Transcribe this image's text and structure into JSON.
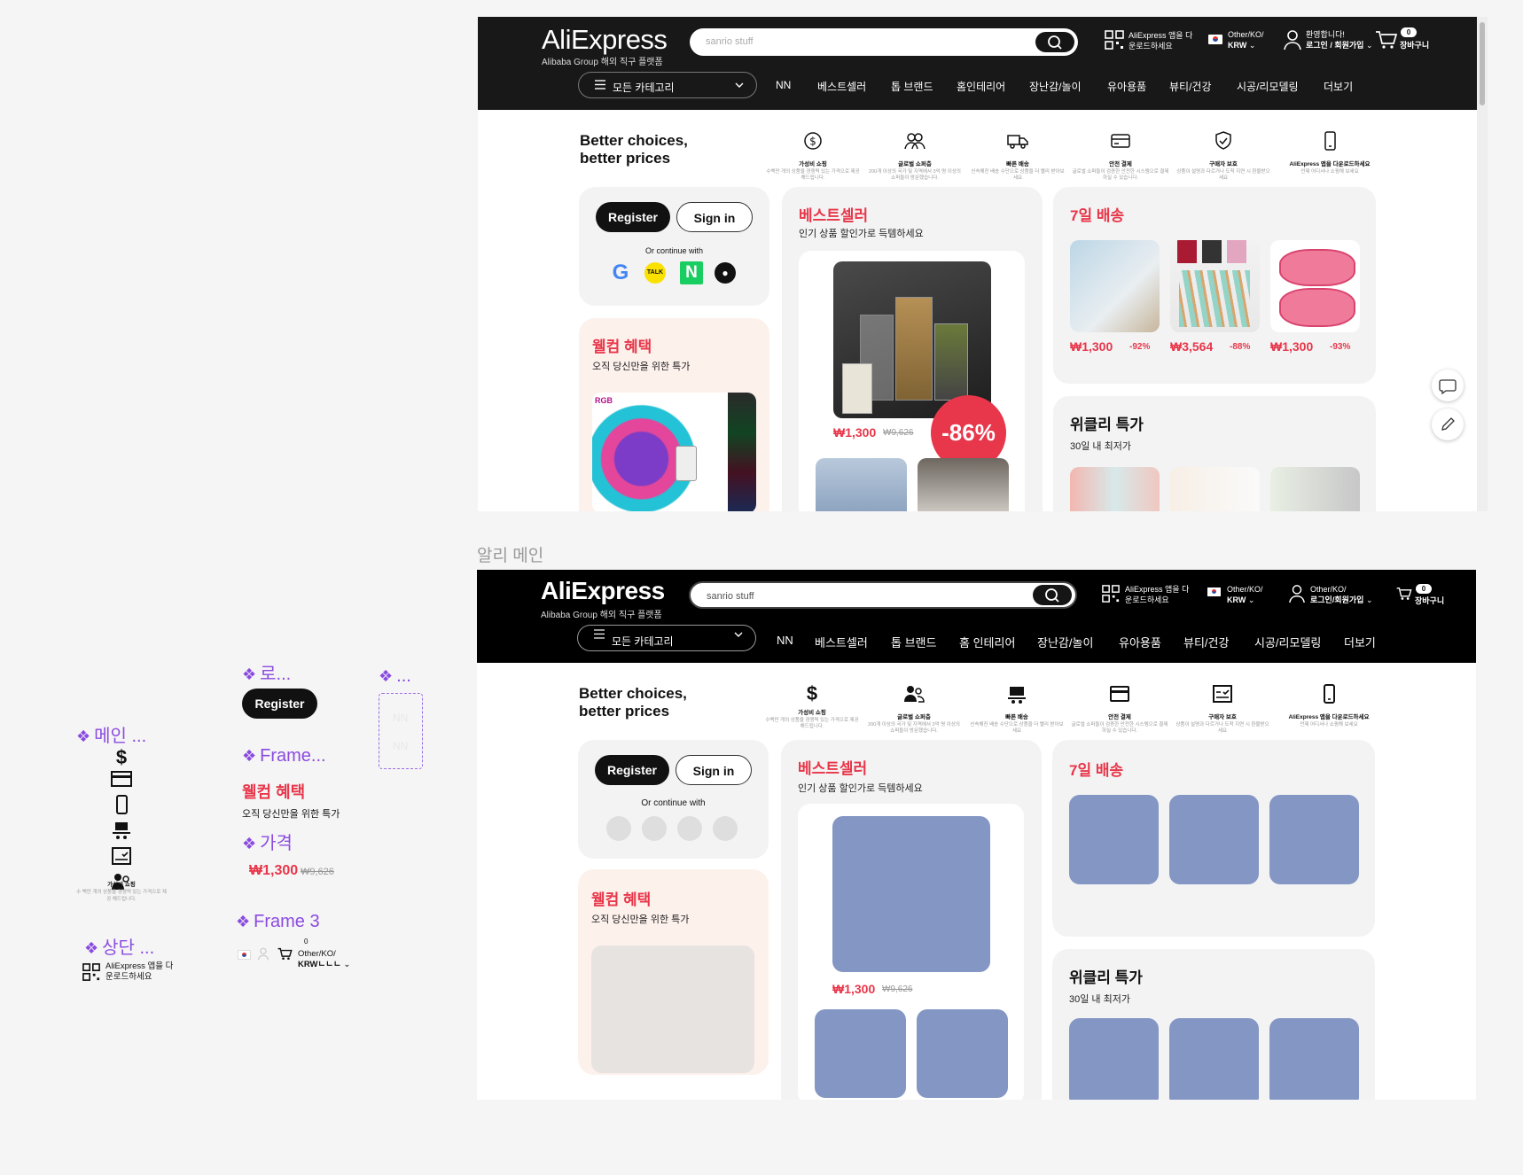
{
  "header": {
    "logo": "AliExpress",
    "logo_sub": "Alibaba Group 해외 직구 플랫폼",
    "search_placeholder": "sanrio stuff",
    "app_line1": "AliExpress 앱을 다",
    "app_line2": "운로드하세요",
    "region_line1": "Other/KO/",
    "region_line2": "KRW",
    "greeting": "환영합니다!",
    "login_link": "로그인 / 회원가입",
    "cart_count": "0",
    "cart_label": "장바구니",
    "all_categories": "모든 카테고리",
    "nav": [
      "NN",
      "베스트셀러",
      "톱 브랜드",
      "홈인테리어",
      "장난감/놀이",
      "유아용품",
      "뷰티/건강",
      "시공/리모델링",
      "더보기"
    ]
  },
  "header2": {
    "region_line1": "Other/KO/",
    "login_link": "로그인/회원가입",
    "nav": [
      "NN",
      "베스트셀러",
      "톱 브랜드",
      "홈 인테리어",
      "장난감/놀이",
      "유아용품",
      "뷰티/건강",
      "시공/리모델링",
      "더보기"
    ]
  },
  "promo": {
    "title": "Better choices, better prices",
    "features": [
      {
        "icon": "dollar-icon",
        "label": "가성비 쇼핑",
        "desc": "수백만 개의 상품을 경쟁력 있는 가격으로 제공 해드립니다."
      },
      {
        "icon": "users-icon",
        "label": "글로벌 쇼퍼층",
        "desc": "200개 이상의 국가 및 지역에서 3억 명 이상의 쇼퍼들이 방문했습니다."
      },
      {
        "icon": "truck-icon",
        "label": "빠른 배송",
        "desc": "신속해진 배송 수단으로 상품을 더 빨리 받아보세요"
      },
      {
        "icon": "card-icon",
        "label": "안전 결제",
        "desc": "글로벌 쇼퍼들이 검증한 안전한 시스템으로 결제하실 수 있습니다."
      },
      {
        "icon": "shield-check-icon",
        "label": "구매자 보호",
        "desc": "상품이 설명과 다르거나 도착 지연 시 환불받으세요"
      },
      {
        "icon": "phone-icon",
        "label": "AliExpress 앱을 다운로드하세요",
        "desc": "언제 어디서나 쇼핑해 보세요"
      }
    ]
  },
  "auth": {
    "register": "Register",
    "sign_in": "Sign in",
    "continue_with": "Or continue with",
    "providers": [
      "google",
      "kakao",
      "naver",
      "apple"
    ]
  },
  "welcome": {
    "title": "웰컴 혜택",
    "subtitle": "오직 당신만을 위한 특가"
  },
  "bestseller": {
    "title": "베스트셀러",
    "subtitle": "인기 상품 할인가로 득템하세요",
    "price": "₩1,300",
    "old_price": "₩9,626",
    "discount": "-86%"
  },
  "seven_day": {
    "title": "7일 배송",
    "items": [
      {
        "price": "₩1,300",
        "discount": "-92%"
      },
      {
        "price": "₩3,564",
        "discount": "-88%"
      },
      {
        "price": "₩1,300",
        "discount": "-93%"
      }
    ]
  },
  "weekly": {
    "title": "위클리 특가",
    "subtitle": "30일 내 최저가"
  },
  "canvas": {
    "frame_label": "알리 메인",
    "comp_main": "메인 ...",
    "comp_login": "로...",
    "comp_frame": "Frame...",
    "comp_small": "...",
    "comp_price": "가격",
    "comp_frame3": "Frame 3",
    "comp_top": "상단 ...",
    "ghost_nav": [
      "NN",
      "NN"
    ],
    "mini_feature_label": "가성비 쇼핑",
    "mini_feature_desc": "수 백만 개의 상품을 경쟁력 있는 가격으로 제공 해드립니다.",
    "mini_region_line1": "Other/KO/",
    "mini_region_line2": "KRWㄴㄴㄴ",
    "mini_cart_count": "0"
  }
}
